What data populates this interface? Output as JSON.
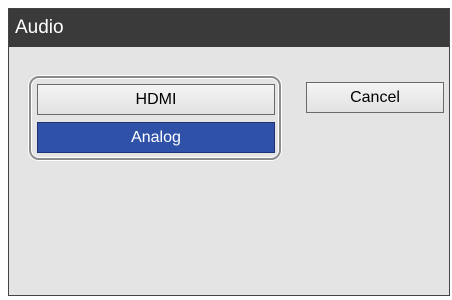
{
  "window": {
    "title": "Audio"
  },
  "options": {
    "items": [
      {
        "label": "HDMI",
        "selected": false
      },
      {
        "label": "Analog",
        "selected": true
      }
    ]
  },
  "actions": {
    "cancel_label": "Cancel"
  },
  "colors": {
    "titlebar": "#3a3a3a",
    "background": "#e4e4e4",
    "selected": "#2f52a8"
  }
}
